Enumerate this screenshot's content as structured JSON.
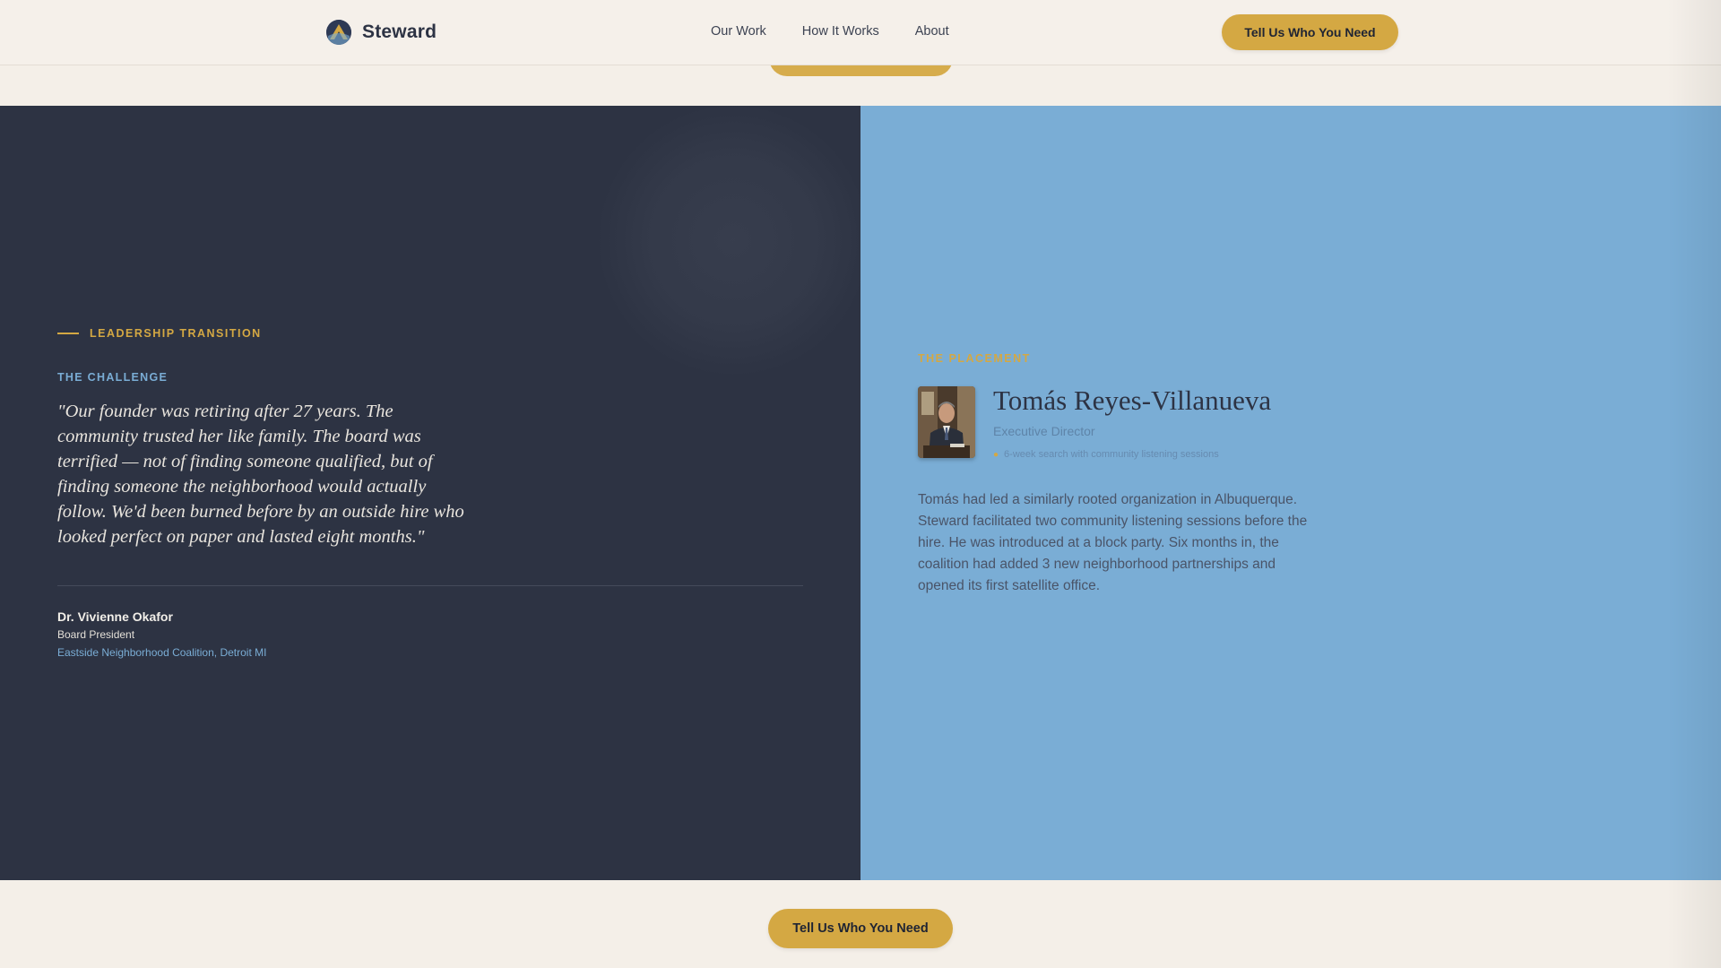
{
  "nav": {
    "brand": "Steward",
    "links": [
      "Our Work",
      "How It Works",
      "About"
    ],
    "cta": "Tell Us Who You Need"
  },
  "challenge": {
    "category": "LEADERSHIP TRANSITION",
    "label": "THE CHALLENGE",
    "quote": "\"Our founder was retiring after 27 years. The community trusted her like family. The board was terrified — not of finding someone qualified, but of finding someone the neighborhood would actually follow. We'd been burned before by an outside hire who looked perfect on paper and lasted eight months.\"",
    "author_name": "Dr. Vivienne Okafor",
    "author_role": "Board President",
    "author_org": "Eastside Neighborhood Coalition, Detroit MI"
  },
  "placement": {
    "label": "THE PLACEMENT",
    "name": "Tomás Reyes-Villanueva",
    "title": "Executive Director",
    "note": "6-week search with community listening sessions",
    "story": "Tomás had led a similarly rooted organization in Albuquerque. Steward facilitated two community listening sessions before the hire. He was introduced at a block party. Six months in, the coalition had added 3 new neighborhood partnerships and opened its first satellite office."
  },
  "footer": {
    "cta": "Tell Us Who You Need"
  },
  "colors": {
    "gold": "#d4a843",
    "navy": "#2d3343",
    "sky": "#7aadd5",
    "cream": "#f4efe8"
  }
}
